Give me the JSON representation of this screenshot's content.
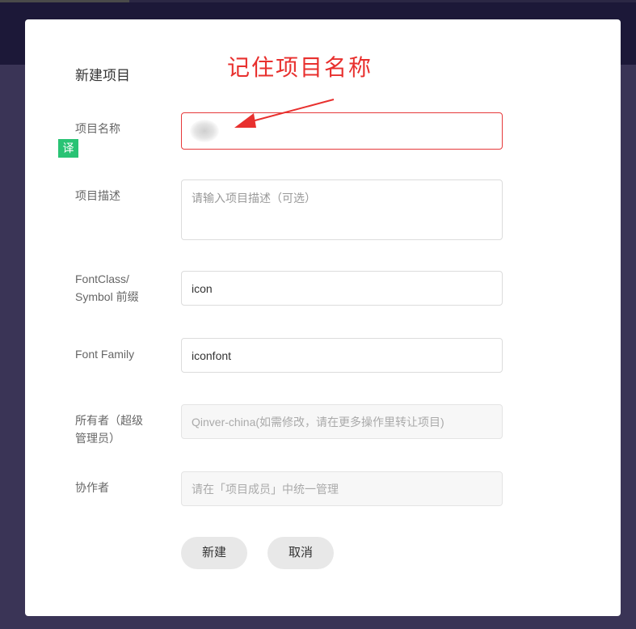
{
  "background": {
    "overlay_color": "#3a3456",
    "topbar_color": "#1c1838"
  },
  "dialog": {
    "title": "新建项目",
    "annotation": "记住项目名称",
    "translate_badge": "译",
    "fields": {
      "name": {
        "label": "项目名称",
        "value": ""
      },
      "description": {
        "label": "项目描述",
        "placeholder": "请输入项目描述（可选）"
      },
      "prefix": {
        "label": "FontClass/\nSymbol 前缀",
        "label_line1": "FontClass/",
        "label_line2": "Symbol 前缀",
        "value": "icon"
      },
      "font_family": {
        "label": "Font Family",
        "value": "iconfont"
      },
      "owner": {
        "label_line1": "所有者（超级",
        "label_line2": "管理员）",
        "value": "Qinver-china(如需修改，请在更多操作里转让项目)"
      },
      "collaborators": {
        "label": "协作者",
        "placeholder": "请在「项目成员」中统一管理"
      }
    },
    "buttons": {
      "create": "新建",
      "cancel": "取消"
    }
  },
  "colors": {
    "error": "#e6393a",
    "annotation": "#e8302e",
    "badge": "#29c374"
  }
}
